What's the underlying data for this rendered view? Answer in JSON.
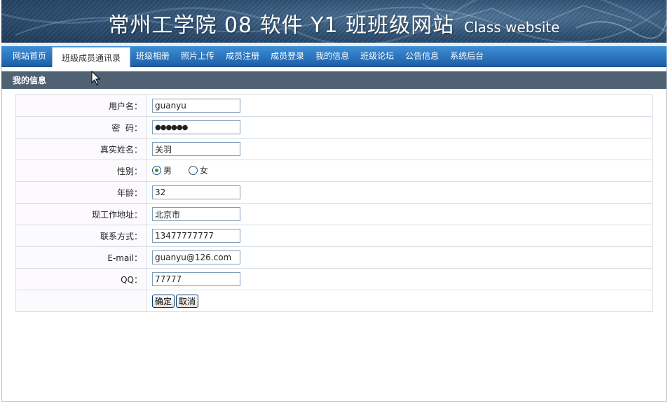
{
  "banner": {
    "title": "常州工学院 08 软件 Y1 班班级网站",
    "subtitle": "Class website"
  },
  "nav": {
    "items": [
      {
        "label": "网站首页",
        "active": false
      },
      {
        "label": "班级成员通讯录",
        "active": true
      },
      {
        "label": "班级相册",
        "active": false
      },
      {
        "label": "照片上传",
        "active": false
      },
      {
        "label": "成员注册",
        "active": false
      },
      {
        "label": "成员登录",
        "active": false
      },
      {
        "label": "我的信息",
        "active": false
      },
      {
        "label": "班级论坛",
        "active": false
      },
      {
        "label": "公告信息",
        "active": false
      },
      {
        "label": "系统后台",
        "active": false
      }
    ]
  },
  "section": {
    "title": "我的信息"
  },
  "form": {
    "username": {
      "label": "用户名：",
      "value": "guanyu"
    },
    "password": {
      "label": "密  码：",
      "value": "●●●●●●"
    },
    "realname": {
      "label": "真实姓名：",
      "value": "关羽"
    },
    "gender": {
      "label": "性别：",
      "options": [
        "男",
        "女"
      ],
      "selected": "男"
    },
    "age": {
      "label": "年龄：",
      "value": "32"
    },
    "address": {
      "label": "现工作地址：",
      "value": "北京市"
    },
    "contact": {
      "label": "联系方式：",
      "value": "13477777777"
    },
    "email": {
      "label": "E-mail：",
      "value": "guanyu@126.com"
    },
    "qq": {
      "label": "QQ：",
      "value": "77777"
    },
    "buttons": {
      "confirm": "确定",
      "cancel": "取消"
    }
  },
  "colors": {
    "nav": "#2a74bd",
    "section": "#4f6273",
    "banner": "#2d4f72"
  }
}
